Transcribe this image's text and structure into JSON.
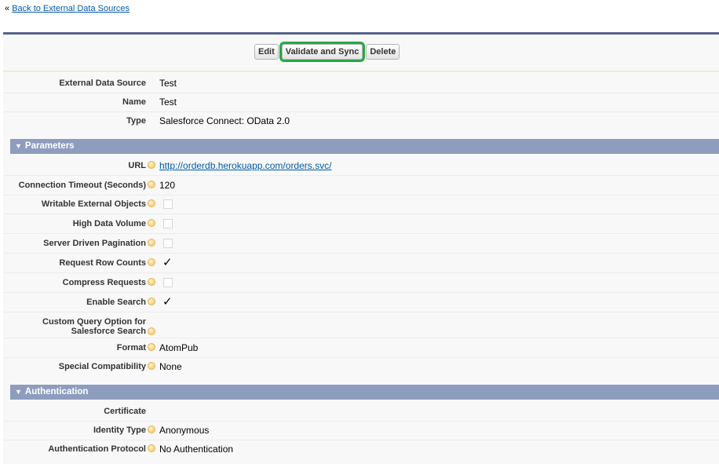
{
  "back_link": {
    "prefix": "«",
    "label": "Back to External Data Sources"
  },
  "buttons": {
    "edit": "Edit",
    "validate": "Validate and Sync",
    "delete": "Delete"
  },
  "details": {
    "external_data_source": {
      "label": "External Data Source",
      "value": "Test"
    },
    "name": {
      "label": "Name",
      "value": "Test"
    },
    "type": {
      "label": "Type",
      "value": "Salesforce Connect: OData 2.0"
    }
  },
  "parameters": {
    "title": "Parameters",
    "url": {
      "label": "URL",
      "value": "http://orderdb.herokuapp.com/orders.svc/"
    },
    "timeout": {
      "label": "Connection Timeout (Seconds)",
      "value": "120"
    },
    "writable": {
      "label": "Writable External Objects",
      "checked": false
    },
    "high_volume": {
      "label": "High Data Volume",
      "checked": false
    },
    "pagination": {
      "label": "Server Driven Pagination",
      "checked": false
    },
    "row_counts": {
      "label": "Request Row Counts",
      "checked": true,
      "mark": "✓"
    },
    "compress": {
      "label": "Compress Requests",
      "checked": false
    },
    "enable_search": {
      "label": "Enable Search",
      "checked": true,
      "mark": "✓"
    },
    "custom_query": {
      "label_line1": "Custom Query Option for",
      "label_line2": "Salesforce Search",
      "value": ""
    },
    "format": {
      "label": "Format",
      "value": "AtomPub"
    },
    "compat": {
      "label": "Special Compatibility",
      "value": "None"
    }
  },
  "authentication": {
    "title": "Authentication",
    "certificate": {
      "label": "Certificate",
      "value": ""
    },
    "identity_type": {
      "label": "Identity Type",
      "value": "Anonymous"
    },
    "protocol": {
      "label": "Authentication Protocol",
      "value": "No Authentication"
    }
  },
  "colors": {
    "section_header": "#8e9dbe",
    "highlight": "#27a844",
    "link": "#015ba7"
  },
  "icons": {
    "help": "help-bubble-icon",
    "collapse": "triangle-down-icon"
  }
}
